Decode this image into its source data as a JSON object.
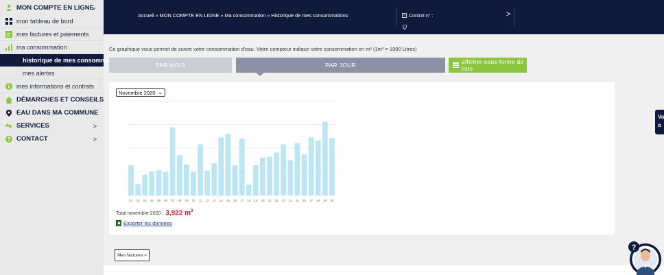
{
  "sidebar": {
    "items": [
      {
        "label": "MON COMPTE EN LIGNE",
        "arrow": "⌄",
        "icon": "user-icon"
      },
      {
        "label": "mon tableau de bord",
        "icon": "dashboard-icon"
      },
      {
        "label": "mes factures et paiements",
        "icon": "invoice-icon"
      },
      {
        "label": "ma consommation",
        "icon": "bar-chart-icon"
      },
      {
        "label": "historique de mes consommations"
      },
      {
        "label": "mes alertes"
      },
      {
        "label": "mes informations et contrats",
        "icon": "info-icon"
      },
      {
        "label": "DÉMARCHES ET CONSEILS",
        "arrow": ">",
        "icon": "house-icon"
      },
      {
        "label": "EAU DANS MA COMMUNE",
        "arrow": ">",
        "icon": "pin-icon"
      },
      {
        "label": "SERVICES",
        "arrow": ">",
        "icon": "faucet-icon"
      },
      {
        "label": "CONTACT",
        "arrow": ">",
        "icon": "question-icon"
      }
    ]
  },
  "header": {
    "breadcrumb": "Accueil » MON COMPTE EN LIGNE » Ma consommation » Historique de mes consommations",
    "contract_label": "Contrat n° :",
    "contract_arrow": ">"
  },
  "main": {
    "description": "Ce graphique vous permet de suivre votre consommation d'eau. Votre compteur indique votre consommation en m³ (1m³ = 1000 Litres)",
    "tabs": {
      "mois": "PAR MOIS",
      "jour": "PAR JOUR",
      "liste": "afficher sous forme de liste"
    },
    "month_select": "Novembre 2020",
    "total_label": "Total novembre 2020 :",
    "total_value": "3,922 m",
    "total_unit_sup": "3",
    "export_label": "Exporter les données",
    "mes_factures_button": "Mes factures >",
    "side_tab": "Vo a"
  },
  "colors": {
    "navy": "#0f1a3d",
    "bar": "#bde6f3",
    "green": "#8cc63f",
    "total_red": "#c4173e"
  },
  "chart_data": {
    "type": "bar",
    "categories": [
      "01",
      "02",
      "03",
      "04",
      "05",
      "06",
      "07",
      "08",
      "09",
      "10",
      "11",
      "12",
      "13",
      "14",
      "15",
      "16",
      "17",
      "18",
      "19",
      "20",
      "21",
      "22",
      "23",
      "24",
      "25",
      "26",
      "27",
      "28",
      "29",
      "30"
    ],
    "values": [
      96,
      36,
      66,
      76,
      80,
      74,
      216,
      128,
      98,
      74,
      162,
      78,
      102,
      184,
      196,
      96,
      180,
      34,
      96,
      120,
      122,
      136,
      162,
      112,
      166,
      130,
      184,
      174,
      234,
      182
    ],
    "ylim": [
      0,
      300
    ],
    "grid": true
  }
}
